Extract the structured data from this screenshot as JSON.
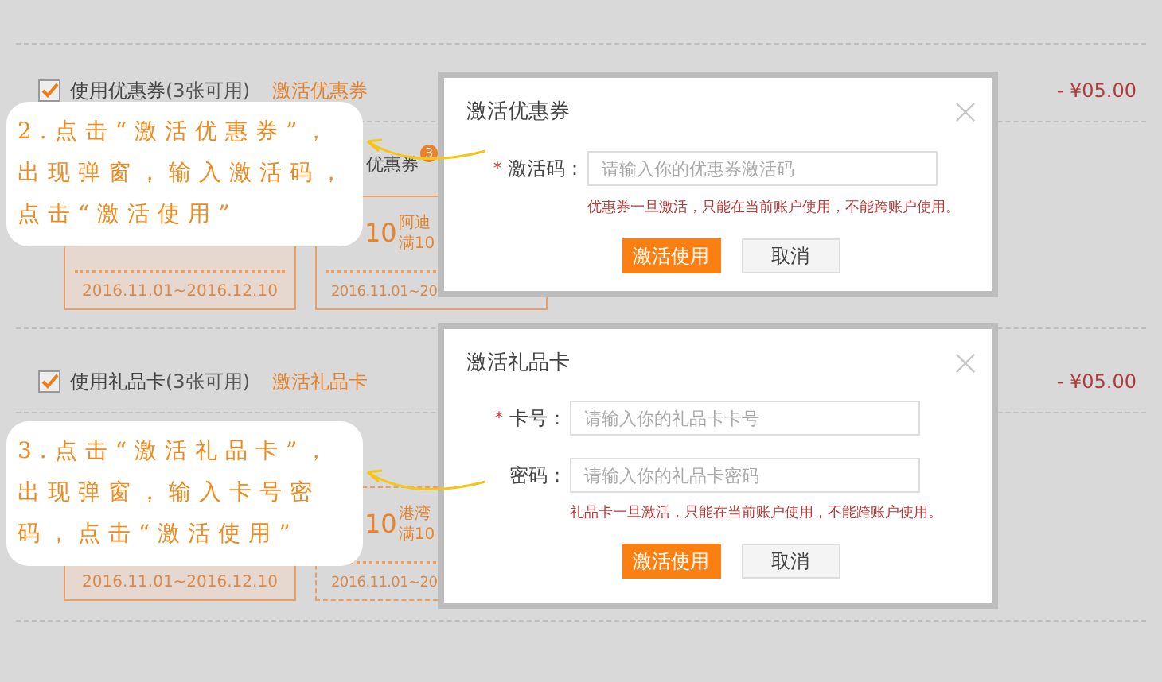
{
  "sections": [
    {
      "checkbox": {
        "checked": true
      },
      "label": "使用优惠券",
      "count": "(3张可用)",
      "link": "激活优惠券",
      "amount": "- ¥05.00",
      "tab": {
        "label": "优惠券",
        "badge": "3"
      },
      "coupons": [
        {
          "selected": true,
          "dashed": false,
          "date": "2016.11.01~2016.12.10"
        },
        {
          "selected": false,
          "dashed": false,
          "amount": "10",
          "name": "阿迪",
          "condition": "满10",
          "date": "2016.11.01~20"
        }
      ]
    },
    {
      "checkbox": {
        "checked": true
      },
      "label": "使用礼品卡",
      "count": "(3张可用)",
      "link": "激活礼品卡",
      "amount": "- ¥05.00",
      "coupons": [
        {
          "selected": true,
          "dashed": false,
          "date": "2016.11.01~2016.12.10"
        },
        {
          "selected": false,
          "dashed": true,
          "amount": "10",
          "name": "港湾",
          "condition": "满10",
          "date": "2016.11.01~20"
        }
      ]
    }
  ],
  "dialogs": [
    {
      "title": "激活优惠券",
      "fields": [
        {
          "marker": "*",
          "label": "激活码：",
          "placeholder": "请输入你的优惠券激活码"
        }
      ],
      "note": "优惠券一旦激活，只能在当前账户使用，不能跨账户使用。",
      "buttons": [
        {
          "label": "激活使用",
          "kind": "primary"
        },
        {
          "label": "取消",
          "kind": "secondary"
        }
      ]
    },
    {
      "title": "激活礼品卡",
      "fields": [
        {
          "marker": "*",
          "label": "卡号：",
          "placeholder": "请输入你的礼品卡卡号"
        },
        {
          "label": "密码：",
          "placeholder": "请输入你的礼品卡密码"
        }
      ],
      "note": "礼品卡一旦激活，只能在当前账户使用，不能跨账户使用。",
      "buttons": [
        {
          "label": "激活使用",
          "kind": "primary"
        },
        {
          "label": "取消",
          "kind": "secondary"
        }
      ]
    }
  ],
  "callouts": [
    {
      "text": "2.点击“激活优惠券”，出现弹窗，输入激活码，点击“激活使用”"
    },
    {
      "text": "3.点击“激活礼品卡”，出现弹窗，输入卡号密码，点击“激活使用”"
    }
  ]
}
